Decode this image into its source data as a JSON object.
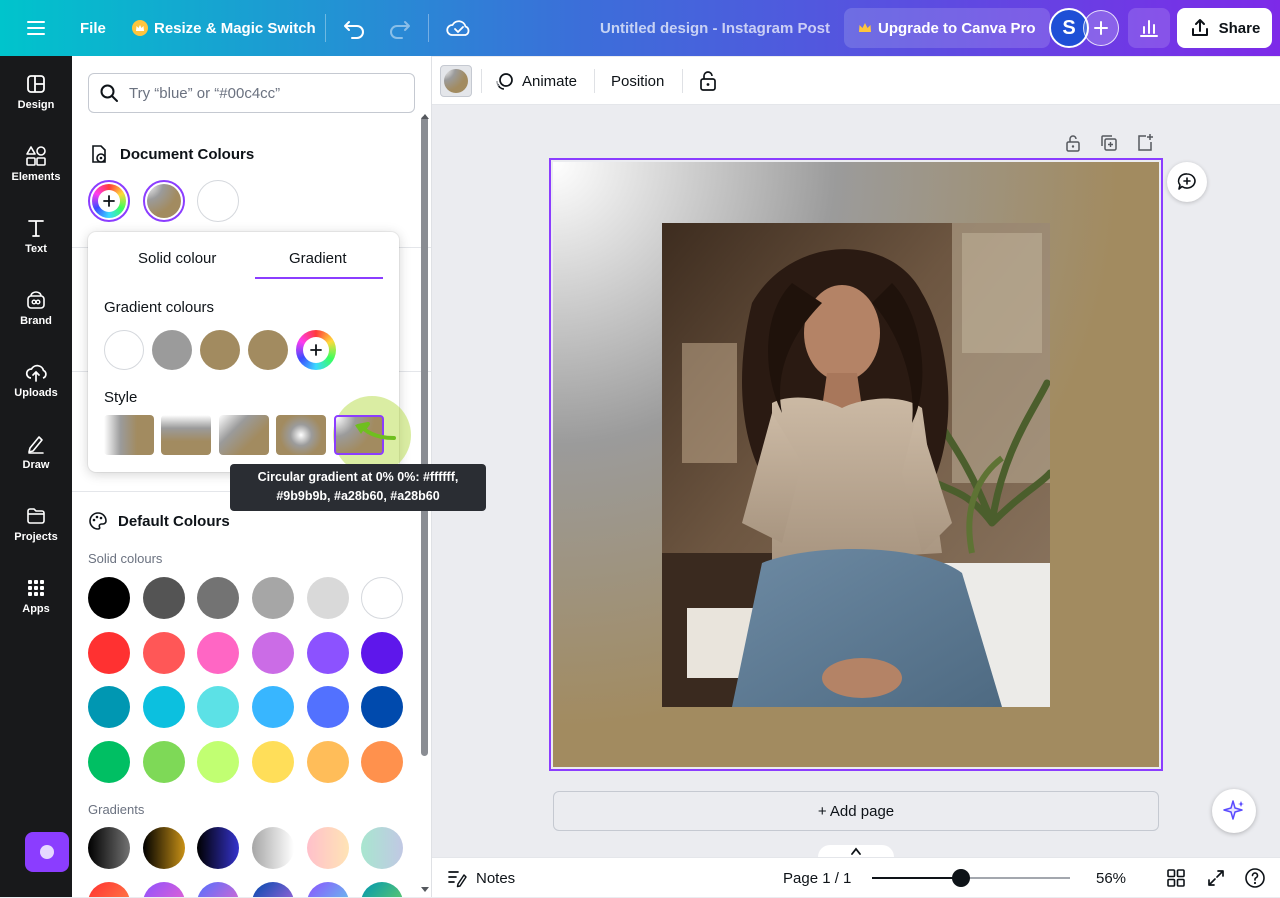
{
  "topbar": {
    "file_label": "File",
    "resize_label": "Resize & Magic Switch",
    "doc_title": "Untitled design - Instagram Post",
    "upgrade_label": "Upgrade to Canva Pro",
    "avatar_initial": "S",
    "share_label": "Share",
    "brand_gradient": [
      "#00c4cc",
      "#7d2ae8"
    ]
  },
  "rail": {
    "items": [
      {
        "label": "Design",
        "icon": "layout-icon"
      },
      {
        "label": "Elements",
        "icon": "shapes-icon"
      },
      {
        "label": "Text",
        "icon": "text-icon"
      },
      {
        "label": "Brand",
        "icon": "brand-icon"
      },
      {
        "label": "Uploads",
        "icon": "cloud-upload-icon"
      },
      {
        "label": "Draw",
        "icon": "pen-icon"
      },
      {
        "label": "Projects",
        "icon": "folder-icon"
      },
      {
        "label": "Apps",
        "icon": "apps-grid-icon"
      }
    ]
  },
  "panel": {
    "search_placeholder": "Try “blue” or “#00c4cc”",
    "document_colours_label": "Document Colours",
    "default_colours_label": "Default Colours",
    "solid_colours_label": "Solid colours",
    "gradients_label": "Gradients",
    "solid_colours": [
      "#000000",
      "#545454",
      "#737373",
      "#a6a6a6",
      "#d9d9d9",
      "#ffffff",
      "#ff3131",
      "#ff5757",
      "#ff66c4",
      "#cb6ce6",
      "#8c52ff",
      "#5e17eb",
      "#0097b2",
      "#0cc0df",
      "#5ce1e6",
      "#38b6ff",
      "#5271ff",
      "#004aad",
      "#00bf63",
      "#7ed957",
      "#c1ff72",
      "#ffde59",
      "#ffbd59",
      "#ff914d"
    ],
    "gradient_swatches": [
      [
        "#000000",
        "#737373"
      ],
      [
        "#000000",
        "#c89116"
      ],
      [
        "#000000",
        "#3533cd"
      ],
      [
        "#a6a6a6",
        "#ffffff"
      ],
      [
        "#ffc0cb",
        "#ffe4b5"
      ],
      [
        "#a8e6cf",
        "#c1c8e4"
      ]
    ]
  },
  "popover": {
    "tab_solid": "Solid colour",
    "tab_gradient": "Gradient",
    "gradient_colours_label": "Gradient colours",
    "style_label": "Style",
    "gradient_colours": [
      "#ffffff",
      "#9b9b9b",
      "#a28b60",
      "#a28b60"
    ]
  },
  "tooltip": {
    "line1": "Circular gradient at 0% 0%: #ffffff,",
    "line2": "#9b9b9b, #a28b60, #a28b60"
  },
  "editor_toolbar": {
    "animate_label": "Animate",
    "position_label": "Position"
  },
  "canvas": {
    "add_page_label": "+ Add page",
    "accent": "#8b3dff"
  },
  "footer": {
    "notes_label": "Notes",
    "page_indicator": "Page 1 / 1",
    "zoom_label": "56%",
    "zoom_fraction": 0.45
  }
}
